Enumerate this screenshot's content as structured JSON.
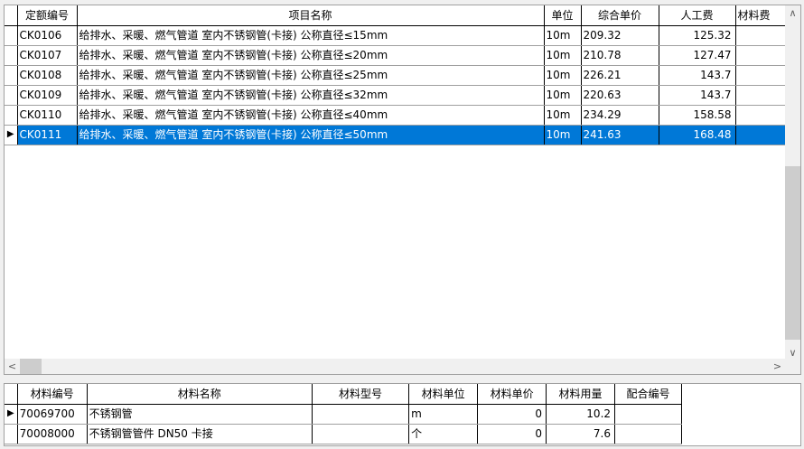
{
  "top_table": {
    "columns": [
      "定额编号",
      "项目名称",
      "单位",
      "综合单价",
      "人工费",
      "材料费"
    ],
    "rows": [
      {
        "code": "CK0106",
        "name": "给排水、采暖、燃气管道 室内不锈钢管(卡接) 公称直径≤15mm",
        "unit": "10m",
        "price": "209.32",
        "labor": "125.32"
      },
      {
        "code": "CK0107",
        "name": "给排水、采暖、燃气管道 室内不锈钢管(卡接) 公称直径≤20mm",
        "unit": "10m",
        "price": "210.78",
        "labor": "127.47"
      },
      {
        "code": "CK0108",
        "name": "给排水、采暖、燃气管道 室内不锈钢管(卡接) 公称直径≤25mm",
        "unit": "10m",
        "price": "226.21",
        "labor": "143.7"
      },
      {
        "code": "CK0109",
        "name": "给排水、采暖、燃气管道 室内不锈钢管(卡接) 公称直径≤32mm",
        "unit": "10m",
        "price": "220.63",
        "labor": "143.7"
      },
      {
        "code": "CK0110",
        "name": "给排水、采暖、燃气管道 室内不锈钢管(卡接) 公称直径≤40mm",
        "unit": "10m",
        "price": "234.29",
        "labor": "158.58"
      },
      {
        "code": "CK0111",
        "name": "给排水、采暖、燃气管道 室内不锈钢管(卡接) 公称直径≤50mm",
        "unit": "10m",
        "price": "241.63",
        "labor": "168.48"
      }
    ],
    "selected_index": 5
  },
  "bottom_table": {
    "columns": [
      "材料编号",
      "材料名称",
      "材料型号",
      "材料单位",
      "材料单价",
      "材料用量",
      "配合编号"
    ],
    "rows": [
      {
        "code": "70069700",
        "name": "不锈钢管",
        "model": "",
        "unit": "m",
        "price": "0",
        "qty": "10.2",
        "mix": ""
      },
      {
        "code": "70008000",
        "name": "不锈钢管管件 DN50 卡接",
        "model": "",
        "unit": "个",
        "price": "0",
        "qty": "7.6",
        "mix": ""
      }
    ]
  },
  "scroll": {
    "up": "∧",
    "down": "∨",
    "left": "<",
    "right": ">"
  },
  "indicator": "▶",
  "selection_color": "#0078d7"
}
